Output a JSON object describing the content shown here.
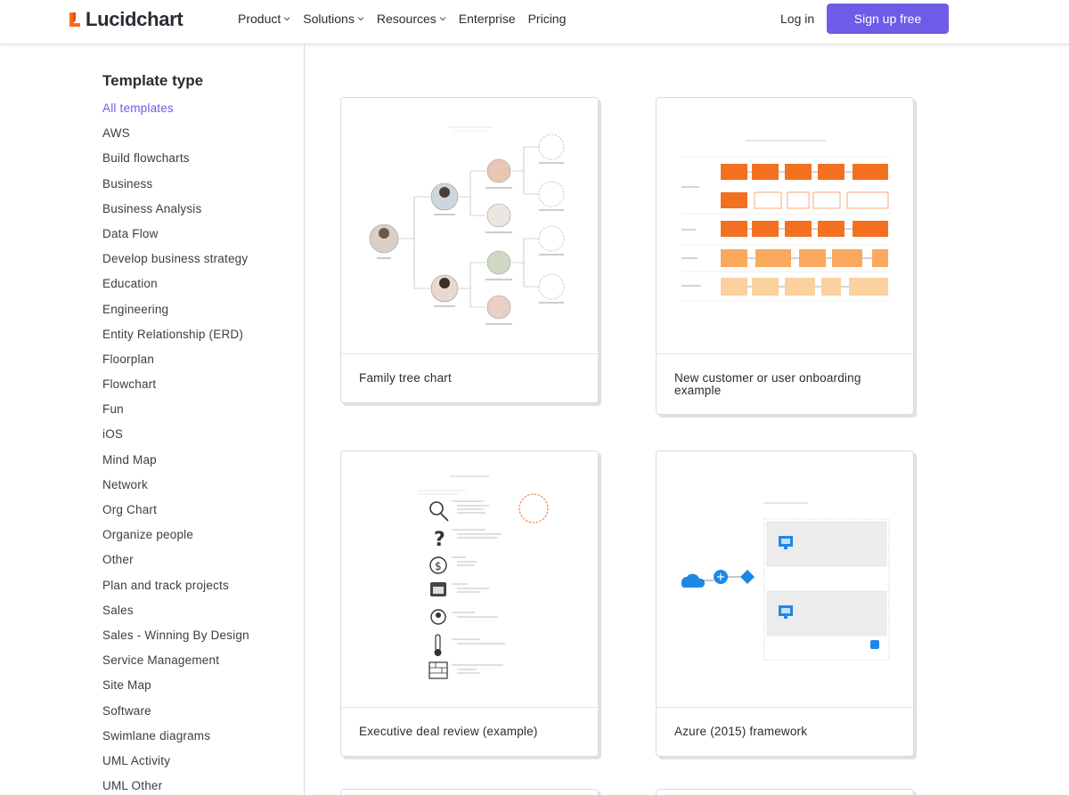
{
  "header": {
    "logo_text": "Lucidchart",
    "nav": [
      "Product",
      "Solutions",
      "Resources",
      "Enterprise",
      "Pricing"
    ],
    "login_label": "Log in",
    "signup_label": "Sign up free",
    "brand_color": "#f96b13",
    "accent_color": "#6c5ce7"
  },
  "sidebar": {
    "title": "Template type",
    "items": [
      "All templates",
      "AWS",
      "Build flowcharts",
      "Business",
      "Business Analysis",
      "Data Flow",
      "Develop business strategy",
      "Education",
      "Engineering",
      "Entity Relationship (ERD)",
      "Floorplan",
      "Flowchart",
      "Fun",
      "iOS",
      "Mind Map",
      "Network",
      "Org Chart",
      "Organize people",
      "Other",
      "Plan and track projects",
      "Sales",
      "Sales - Winning By Design",
      "Service Management",
      "Site Map",
      "Software",
      "Swimlane diagrams",
      "UML Activity",
      "UML Other"
    ],
    "active_index": 0
  },
  "cards": [
    {
      "title": "Family tree chart"
    },
    {
      "title": "New customer or user onboarding example"
    },
    {
      "title": "Executive deal review (example)"
    },
    {
      "title": "Azure (2015) framework"
    }
  ]
}
